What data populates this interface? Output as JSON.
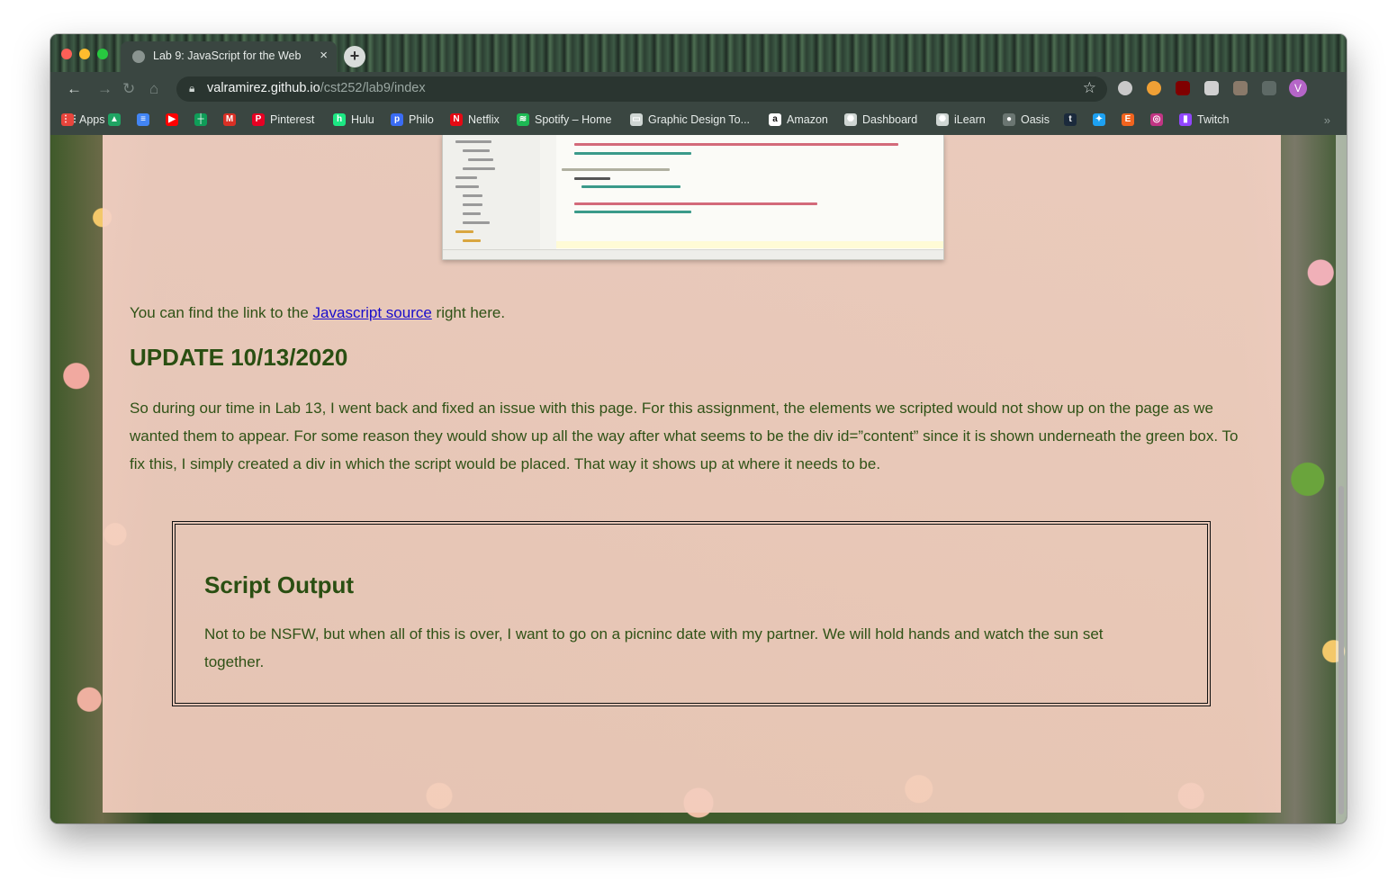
{
  "tab": {
    "title": "Lab 9: JavaScript for the Web",
    "close": "×",
    "new_tab": "+"
  },
  "toolbar": {
    "url_host": "valramirez.github.io",
    "url_path": "/cst252/lab9/index",
    "avatar_initial": "V"
  },
  "bookmarks": {
    "items": [
      {
        "label": "Apps",
        "icon": "apps-grid-icon",
        "color": "#e8453c"
      },
      {
        "label": "",
        "icon": "google-drive-icon",
        "color": "#1fa463"
      },
      {
        "label": "",
        "icon": "google-docs-icon",
        "color": "#4285f4"
      },
      {
        "label": "",
        "icon": "youtube-icon",
        "color": "#ff0000"
      },
      {
        "label": "",
        "icon": "google-sheets-icon",
        "color": "#0f9d58"
      },
      {
        "label": "",
        "icon": "gmail-icon",
        "color": "#d93025"
      },
      {
        "label": "Pinterest",
        "icon": "pinterest-icon",
        "color": "#e60023"
      },
      {
        "label": "Hulu",
        "icon": "hulu-icon",
        "color": "#1ce783"
      },
      {
        "label": "Philo",
        "icon": "philo-icon",
        "color": "#3a6cf4"
      },
      {
        "label": "Netflix",
        "icon": "netflix-icon",
        "color": "#e50914"
      },
      {
        "label": "Spotify – Home",
        "icon": "spotify-icon",
        "color": "#1db954"
      },
      {
        "label": "Graphic Design To...",
        "icon": "folder-icon",
        "color": "#cfd6d3"
      },
      {
        "label": "Amazon",
        "icon": "amazon-icon",
        "color": "#ffffff"
      },
      {
        "label": "Dashboard",
        "icon": "canvas-icon",
        "color": "#cfd6d3"
      },
      {
        "label": "iLearn",
        "icon": "canvas-icon",
        "color": "#cfd6d3"
      },
      {
        "label": "Oasis",
        "icon": "globe-icon",
        "color": "#6b7672"
      },
      {
        "label": "",
        "icon": "tumblr-icon",
        "color": "#1b2a3c"
      },
      {
        "label": "",
        "icon": "twitter-icon",
        "color": "#1da1f2"
      },
      {
        "label": "",
        "icon": "etsy-icon",
        "color": "#f1641e"
      },
      {
        "label": "",
        "icon": "instagram-icon",
        "color": "#c13584"
      },
      {
        "label": "Twitch",
        "icon": "twitch-icon",
        "color": "#9146ff"
      }
    ],
    "more": "»"
  },
  "page": {
    "link_intro": "You can find the link to the ",
    "link_text": "Javascript source",
    "link_outro": " right here.",
    "update_heading": "UPDATE 10/13/2020",
    "update_body": "So during our time in Lab 13, I went back and fixed an issue with this page. For this assignment, the elements we scripted would not show up on the page as we wanted them to appear. For some reason they would show up all the way after what seems to be the div id=”content” since it is shown underneath the green box. To fix this, I simply created a div in which the script would be placed. That way it shows up at where it needs to be.",
    "output_heading": "Script Output",
    "output_body": "Not to be NSFW, but when all of this is over, I want to go on a picninc date with my partner. We will hold hands and watch the sun set together."
  },
  "code_screenshot": {
    "lines": [
      "newIEl.innerHTML = \"When all of this is over, I want to go on a picninc date with my partner\";",
      "document.body.appendChild(newIEl);",
      "//Create another second element",
      "var new2El =",
      "document.createElement (\"p2\");",
      "new2El.innerHTML = \"And hold hands and watch the sun setting together\";",
      "document.body.appendChild(new2El);"
    ]
  }
}
